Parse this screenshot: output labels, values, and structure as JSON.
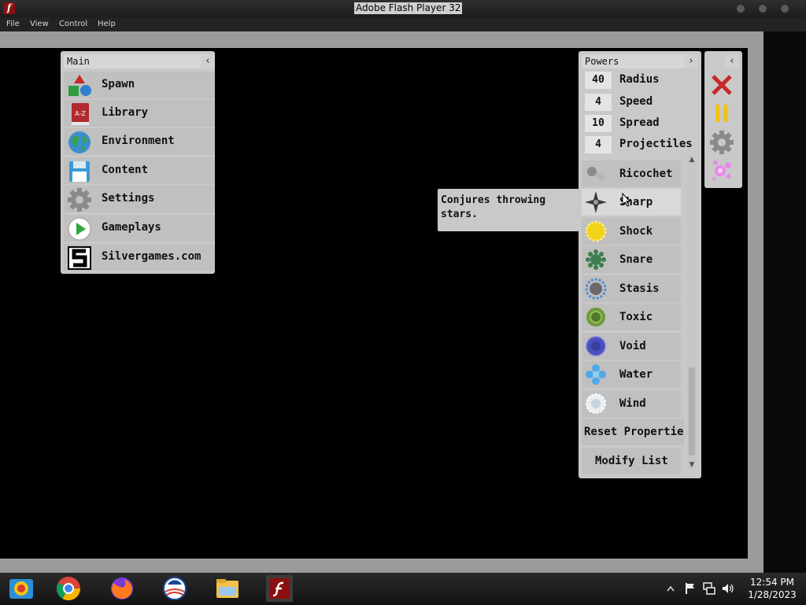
{
  "window": {
    "title": "Adobe Flash Player 32"
  },
  "menubar": {
    "items": [
      "File",
      "View",
      "Control",
      "Help"
    ]
  },
  "main_panel": {
    "title": "Main",
    "collapse_glyph": "‹",
    "items": [
      {
        "label": "Spawn",
        "icon": "shapes-icon"
      },
      {
        "label": "Library",
        "icon": "book-icon"
      },
      {
        "label": "Environment",
        "icon": "globe-icon"
      },
      {
        "label": "Content",
        "icon": "floppy-disk-icon"
      },
      {
        "label": "Settings",
        "icon": "gear-icon"
      },
      {
        "label": "Gameplays",
        "icon": "play-icon"
      },
      {
        "label": "Silvergames.com",
        "icon": "silvergames-logo-icon"
      }
    ],
    "library_icon_text": "A-Z"
  },
  "powers_panel": {
    "title": "Powers",
    "expand_glyph": "›",
    "properties": [
      {
        "value": "40",
        "label": "Radius"
      },
      {
        "value": "4",
        "label": "Speed"
      },
      {
        "value": "10",
        "label": "Spread"
      },
      {
        "value": "4",
        "label": "Projectiles"
      }
    ],
    "powers": [
      {
        "label": "Ricochet",
        "color": "#8a8a8a"
      },
      {
        "label": "Sharp",
        "color": "#3a3a3a"
      },
      {
        "label": "Shock",
        "color": "#f2d21a"
      },
      {
        "label": "Snare",
        "color": "#3f7f4f"
      },
      {
        "label": "Stasis",
        "color": "#4f8fd0"
      },
      {
        "label": "Toxic",
        "color": "#6f9a3a"
      },
      {
        "label": "Void",
        "color": "#4a4fc0"
      },
      {
        "label": "Water",
        "color": "#4fa8e8"
      },
      {
        "label": "Wind",
        "color": "#e8eef2"
      }
    ],
    "reset_label": "Reset Properties",
    "modify_label": "Modify List",
    "scroll_up": "▲",
    "scroll_down": "▼"
  },
  "tooltip": {
    "text": "Conjures throwing stars."
  },
  "side_toolbar": {
    "collapse_glyph": "‹",
    "buttons": [
      "close-icon",
      "pause-icon",
      "gear-icon",
      "particles-icon"
    ]
  },
  "taskbar": {
    "apps": [
      "file-explorer-app-icon",
      "chrome-app-icon",
      "firefox-app-icon",
      "obama-app-icon",
      "folder-app-icon",
      "flash-player-app-icon"
    ],
    "time": "12:54 PM",
    "date": "1/28/2023"
  }
}
